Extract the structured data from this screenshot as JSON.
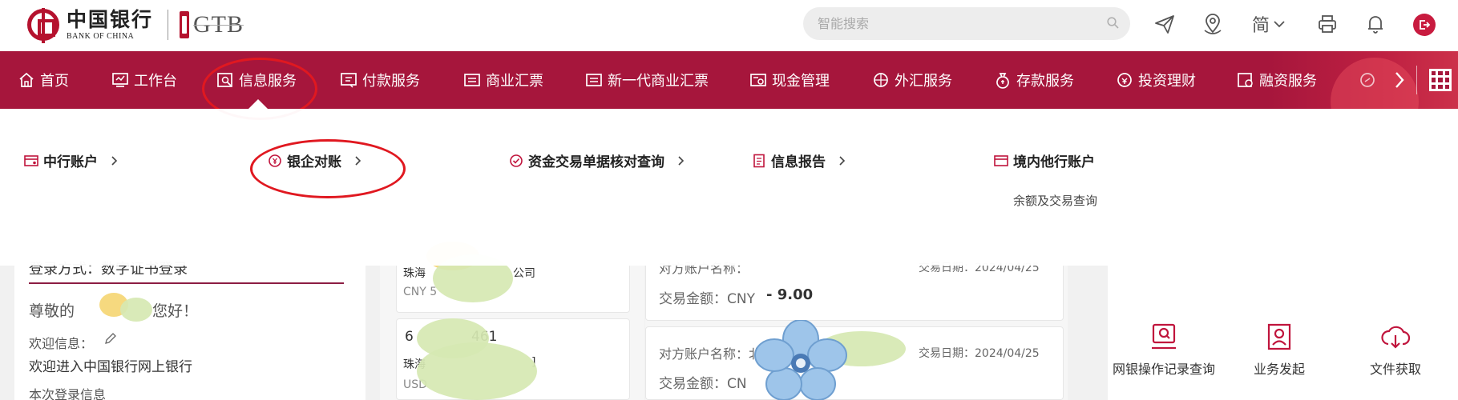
{
  "header": {
    "bank_name_cn": "中国银行",
    "bank_name_en": "BANK OF CHINA",
    "gtb_label": "GTB",
    "search_placeholder": "智能搜索",
    "language_label": "简"
  },
  "nav": {
    "items": [
      {
        "label": "首页",
        "icon": "home-icon"
      },
      {
        "label": "工作台",
        "icon": "monitor-icon"
      },
      {
        "label": "信息服务",
        "icon": "info-search-icon"
      },
      {
        "label": "付款服务",
        "icon": "payment-icon"
      },
      {
        "label": "商业汇票",
        "icon": "bill-icon"
      },
      {
        "label": "新一代商业汇票",
        "icon": "bill-icon"
      },
      {
        "label": "现金管理",
        "icon": "cash-icon"
      },
      {
        "label": "外汇服务",
        "icon": "forex-icon"
      },
      {
        "label": "存款服务",
        "icon": "deposit-icon"
      },
      {
        "label": "投资理财",
        "icon": "invest-icon"
      },
      {
        "label": "融资服务",
        "icon": "finance-icon"
      }
    ]
  },
  "dropdown": {
    "items": [
      {
        "label": "中行账户",
        "icon": "account-card-icon"
      },
      {
        "label": "银企对账",
        "icon": "reconcile-icon"
      },
      {
        "label": "资金交易单据核对查询",
        "icon": "document-check-icon"
      },
      {
        "label": "信息报告",
        "icon": "report-icon"
      },
      {
        "label": "境内他行账户",
        "icon": "other-bank-card-icon"
      }
    ],
    "sub_link": "余额及交易查询"
  },
  "left_panel": {
    "login_method": "登录方式：数字证书登录",
    "greeting_prefix": "尊敬的",
    "greeting_suffix": "您好！",
    "welcome_label": "欢迎信息：",
    "welcome_text": "欢迎进入中国银行网上银行",
    "login_info": "本次登录信息"
  },
  "accounts": [
    {
      "name_prefix": "珠海",
      "name_suffix": "公司",
      "currency": "CNY 5"
    },
    {
      "number_prefix": "6",
      "number_suffix": "461",
      "name_prefix": "珠海",
      "name_suffix": "]",
      "currency": "USD"
    }
  ],
  "transactions": [
    {
      "counterparty_label": "对方账户名称：",
      "date_label": "交易日期：2024/04/25",
      "amount_label": "交易金额：CNY",
      "amount": "- 9.00"
    },
    {
      "counterparty_label": "对方账户名称：北",
      "date_label": "交易日期：2024/04/25",
      "amount_label": "交易金额：CN"
    }
  ],
  "quick_actions": [
    {
      "label": "网银操作记录查询",
      "icon": "record-search-icon"
    },
    {
      "label": "业务发起",
      "icon": "business-start-icon"
    },
    {
      "label": "文件获取",
      "icon": "file-download-icon"
    }
  ],
  "colors": {
    "brand_red": "#a6163c",
    "annotation_red": "#e01820"
  }
}
